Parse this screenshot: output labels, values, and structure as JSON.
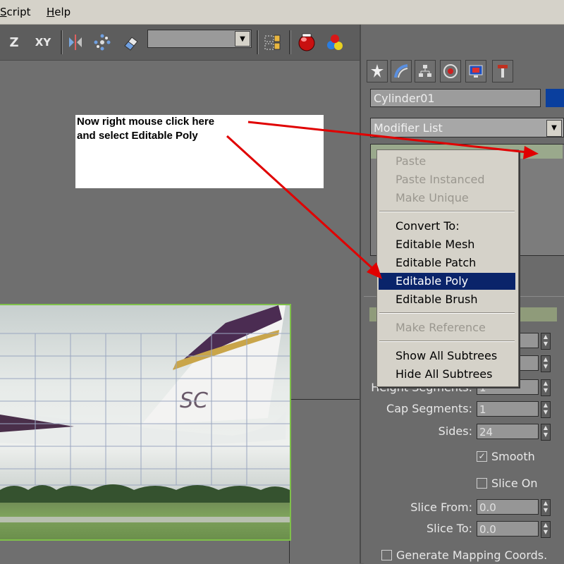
{
  "menubar": {
    "items": [
      "Script",
      "Help"
    ]
  },
  "toolbar": {
    "z_label": "Z",
    "xy_label": "XY",
    "selection_set_value": ""
  },
  "panel": {
    "object_name": "Cylinder01",
    "object_color": "#0a3f9e",
    "modifier_list": "Modifier List",
    "fields": [
      {
        "label": "Height Segments:",
        "value": "1"
      },
      {
        "label": "Cap Segments:",
        "value": "1"
      },
      {
        "label": "Sides:",
        "value": "24"
      },
      {
        "label": "Slice From:",
        "value": "0.0"
      },
      {
        "label": "Slice To:",
        "value": "0.0"
      }
    ],
    "smooth_label": "Smooth",
    "smooth_checked": true,
    "slice_on_label": "Slice On",
    "slice_on_checked": false,
    "gen_mapping_label": "Generate Mapping Coords."
  },
  "annotation": {
    "line1": "Now right mouse click here",
    "line2": "and select Editable Poly"
  },
  "context_menu": {
    "items": [
      {
        "label": "Paste",
        "state": "disabled"
      },
      {
        "label": "Paste Instanced",
        "state": "disabled"
      },
      {
        "label": "Make Unique",
        "state": "disabled"
      },
      {
        "label": "Convert To:",
        "state": "normal"
      },
      {
        "label": "Editable Mesh",
        "state": "normal"
      },
      {
        "label": "Editable Patch",
        "state": "normal"
      },
      {
        "label": "Editable Poly",
        "state": "highlighted"
      },
      {
        "label": "Editable Brush",
        "state": "normal"
      },
      {
        "label": "Make Reference",
        "state": "disabled"
      },
      {
        "label": "Show All Subtrees",
        "state": "normal"
      },
      {
        "label": "Hide All Subtrees",
        "state": "normal"
      }
    ]
  },
  "colors": {
    "accent_selected": "#0a246a",
    "arrow": "#e00000",
    "plane_border": "#7fc04a"
  },
  "icons": [
    "mirror-icon",
    "array-icon",
    "eraser-icon",
    "layers-icon",
    "render-teapot-icon",
    "material-editor-icon",
    "create-tab-icon",
    "modify-tab-icon",
    "hierarchy-tab-icon",
    "motion-tab-icon",
    "display-tab-icon",
    "utilities-tab-icon"
  ]
}
